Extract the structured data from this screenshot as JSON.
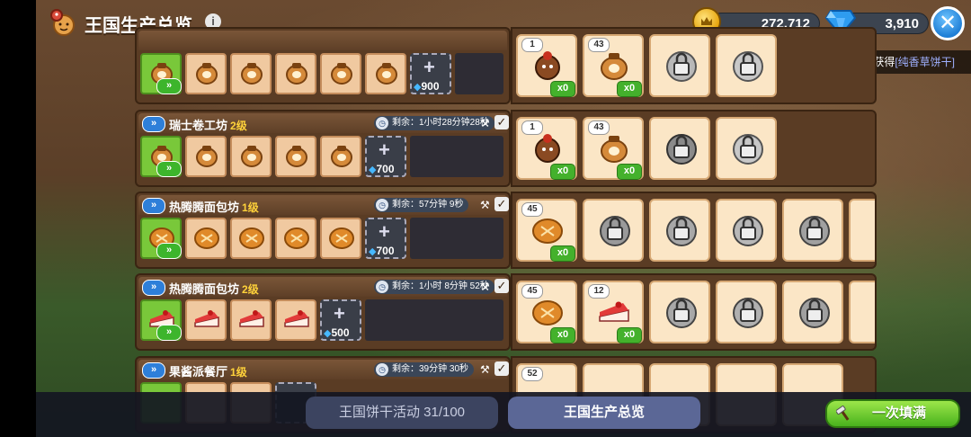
{
  "header": {
    "title": "王国生产总览",
    "info": "i",
    "coins": "272,712",
    "gems": "3,910",
    "close": "✕"
  },
  "toast": {
    "prefix": "[路过的饼干人]获得",
    "item": "[纯香草饼干]"
  },
  "rows": [
    {
      "name": "",
      "level": "",
      "timer": "",
      "cost": "900"
    },
    {
      "name": "瑞士卷工坊",
      "level": "2级",
      "timer": "剩余：1小时28分钟28秒",
      "cost": "700",
      "inventory": [
        "1",
        "43"
      ],
      "x": "x0"
    },
    {
      "name": "热腾腾面包坊",
      "level": "1级",
      "timer": "剩余：57分钟 9秒",
      "cost": "700",
      "inventory": [
        "45"
      ],
      "x": "x0"
    },
    {
      "name": "热腾腾面包坊",
      "level": "2级",
      "timer": "剩余：1小时 8分钟 52秒",
      "cost": "500",
      "inventory": [
        "45",
        "12"
      ],
      "x": "x0"
    },
    {
      "name": "果酱派餐厅",
      "level": "1级",
      "timer": "剩余：39分钟 30秒",
      "inventory": [
        "52"
      ]
    }
  ],
  "top_row_inventory": [
    "1",
    "43"
  ],
  "top_row_x": "x0",
  "bottom": {
    "event_button": "王国饼干活动 31/100",
    "overview_button": "王国生产总览",
    "fill_button": "一次填满"
  },
  "colors": {
    "accent_green": "#49b21d",
    "gem_blue": "#47b8ff",
    "panel_brown": "#5a3c24"
  }
}
